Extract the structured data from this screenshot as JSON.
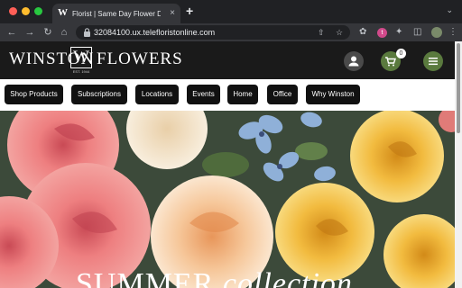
{
  "browser": {
    "tab_title": "Florist | Same Day Flower Deliv",
    "tab_favicon": "W",
    "tab_close": "×",
    "new_tab": "+",
    "url": "32084100.ux.telefloristonline.com",
    "profile_badge": "t"
  },
  "site": {
    "logo_left": "WINSTON",
    "logo_mark": "W",
    "logo_right": "FLOWERS",
    "logo_est": "EST. 1944",
    "cart_count": "0"
  },
  "nav": {
    "items": [
      {
        "label": "Shop Products"
      },
      {
        "label": "Subscriptions"
      },
      {
        "label": "Locations"
      },
      {
        "label": "Events"
      },
      {
        "label": "Home"
      },
      {
        "label": "Office"
      },
      {
        "label": "Why Winston"
      }
    ]
  },
  "hero": {
    "title_plain": "SUMMER",
    "title_italic": "collection"
  },
  "colors": {
    "header_bg": "#1a1a1a",
    "brand_green": "#5a7a3e",
    "nav_button": "#111111"
  }
}
